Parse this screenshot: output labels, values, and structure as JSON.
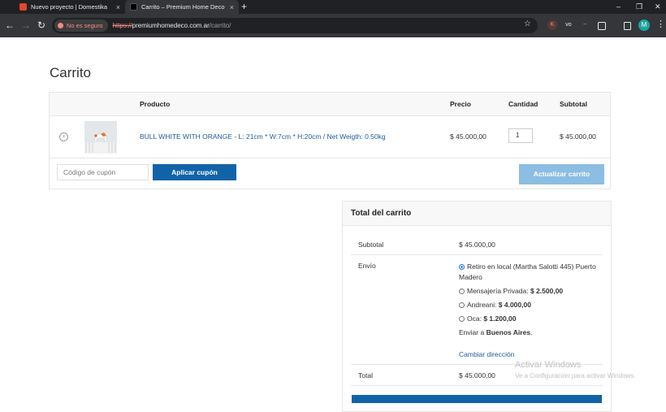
{
  "browser": {
    "tabs": [
      {
        "title": "Nuevo proyecto | Domestika",
        "close": "×"
      },
      {
        "title": "Carrito – Premium Home Deco",
        "close": "×"
      }
    ],
    "new_tab": "+",
    "window_controls": {
      "minimize": "–",
      "restore": "❐",
      "close": "✕"
    },
    "nav": {
      "back": "←",
      "forward": "→",
      "reload": "↻"
    },
    "security_label": "No es seguro",
    "url": {
      "scheme": "https://",
      "host": "premiumhomedeco.com.ar",
      "path": "/carrito/"
    },
    "bookmark": "☆",
    "extensions": [
      "K",
      "vo",
      "~"
    ],
    "profile_initial": "M",
    "menu": "⋮"
  },
  "page": {
    "title": "Carrito",
    "table": {
      "headers": {
        "product": "Producto",
        "price": "Precio",
        "quantity": "Cantidad",
        "subtotal": "Subtotal"
      },
      "items": [
        {
          "remove": "×",
          "name": "BULL WHITE WITH ORANGE - L: 21cm * W:7cm * H:20cm / Net Weigth: 0.50kg",
          "price": "$ 45.000,00",
          "quantity": "1",
          "subtotal": "$ 45.000,00"
        }
      ],
      "coupon_placeholder": "Código de cupón",
      "apply_coupon": "Aplicar cupón",
      "update_cart": "Actualizar carrito"
    },
    "totals": {
      "title": "Total del carrito",
      "subtotal_label": "Subtotal",
      "subtotal_value": "$ 45.000,00",
      "shipping_label": "Envío",
      "shipping_options": [
        {
          "label": "Retiro en local (Martha Salotti 445) Puerto Madero",
          "price": "",
          "selected": true
        },
        {
          "label": "Mensajería Privada:",
          "price": "$ 2.500,00",
          "selected": false
        },
        {
          "label": "Andreani:",
          "price": "$ 4.000,00",
          "selected": false
        },
        {
          "label": "Oca:",
          "price": "$ 1.200,00",
          "selected": false
        }
      ],
      "ship_to_prefix": "Enviar a",
      "ship_to_place": "Buenos Aires",
      "ship_to_suffix": ".",
      "change_address": "Cambiar dirección",
      "total_label": "Total",
      "total_value": "$ 45.000,00"
    }
  },
  "watermark": {
    "line1": "Activar Windows",
    "line2": "Ve a Configuración para activar Windows."
  }
}
